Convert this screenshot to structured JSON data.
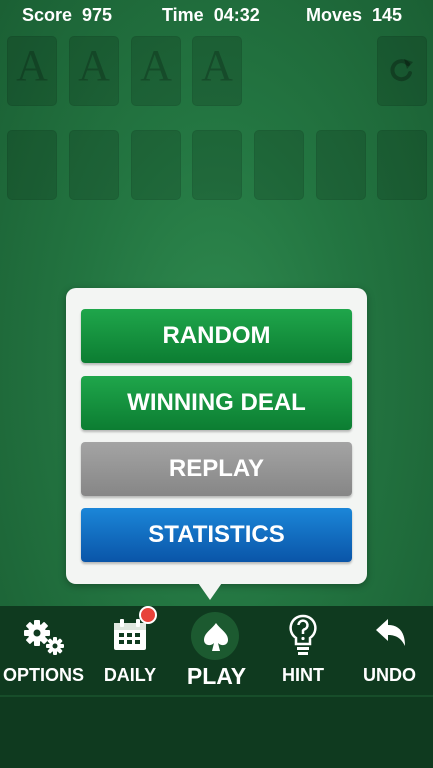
{
  "status": {
    "score_label": "Score",
    "score_value": "975",
    "time_label": "Time",
    "time_value": "04:32",
    "moves_label": "Moves",
    "moves_value": "145"
  },
  "foundations": [
    "A",
    "A",
    "A",
    "A"
  ],
  "stock_icon": "recycle-icon",
  "menu": {
    "buttons": [
      {
        "label": "RANDOM",
        "color": "#159441"
      },
      {
        "label": "WINNING DEAL",
        "color": "#159441"
      },
      {
        "label": "REPLAY",
        "color": "#959595"
      },
      {
        "label": "STATISTICS",
        "color": "#136fc2"
      }
    ]
  },
  "nav": {
    "options": {
      "label": "OPTIONS",
      "icon": "gears-icon"
    },
    "daily": {
      "label": "DAILY",
      "icon": "calendar-icon"
    },
    "play": {
      "label": "PLAY",
      "icon": "spade-icon"
    },
    "hint": {
      "label": "HINT",
      "icon": "lightbulb-question-icon"
    },
    "undo": {
      "label": "UNDO",
      "icon": "undo-arrow-icon"
    }
  },
  "colors": {
    "felt": "#237541",
    "bar": "#0f3a1f",
    "badge": "#e8423a"
  }
}
